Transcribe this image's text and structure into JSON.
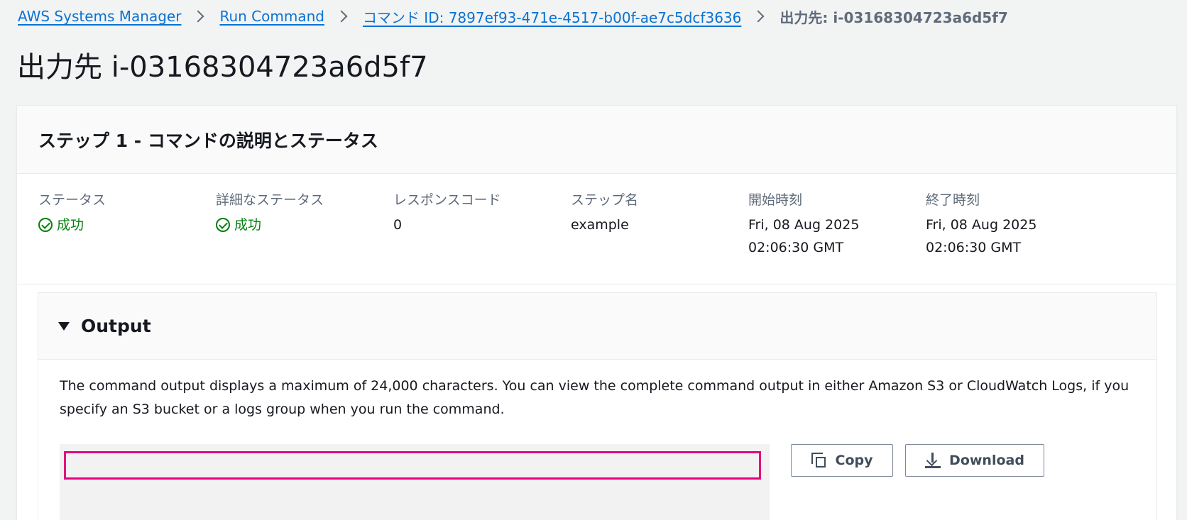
{
  "breadcrumb": {
    "items": [
      {
        "label": "AWS Systems Manager"
      },
      {
        "label": "Run Command"
      },
      {
        "label": "コマンド ID: 7897ef93-471e-4517-b00f-ae7c5dcf3636"
      }
    ],
    "current": "出力先: i-03168304723a6d5f7"
  },
  "page_title": "出力先 i-03168304723a6d5f7",
  "step": {
    "header": "ステップ 1 - コマンドの説明とステータス",
    "fields": {
      "status": {
        "label": "ステータス",
        "value": "成功"
      },
      "detailed_status": {
        "label": "詳細なステータス",
        "value": "成功"
      },
      "response_code": {
        "label": "レスポンスコード",
        "value": "0"
      },
      "step_name": {
        "label": "ステップ名",
        "value": "example"
      },
      "start_time": {
        "label": "開始時刻",
        "value_line1": "Fri, 08 Aug 2025",
        "value_line2": "02:06:30 GMT"
      },
      "end_time": {
        "label": "終了時刻",
        "value_line1": "Fri, 08 Aug 2025",
        "value_line2": "02:06:30 GMT"
      }
    }
  },
  "output": {
    "title": "Output",
    "description": "The command output displays a maximum of 24,000 characters. You can view the complete command output in either Amazon S3 or CloudWatch Logs, if you specify an S3 bucket or a logs group when you run the command.",
    "copy_label": "Copy",
    "download_label": "Download"
  },
  "colors": {
    "link": "#0972d3",
    "success": "#037f0c",
    "highlight": "#e6007e",
    "background": "#f2f3f3"
  }
}
